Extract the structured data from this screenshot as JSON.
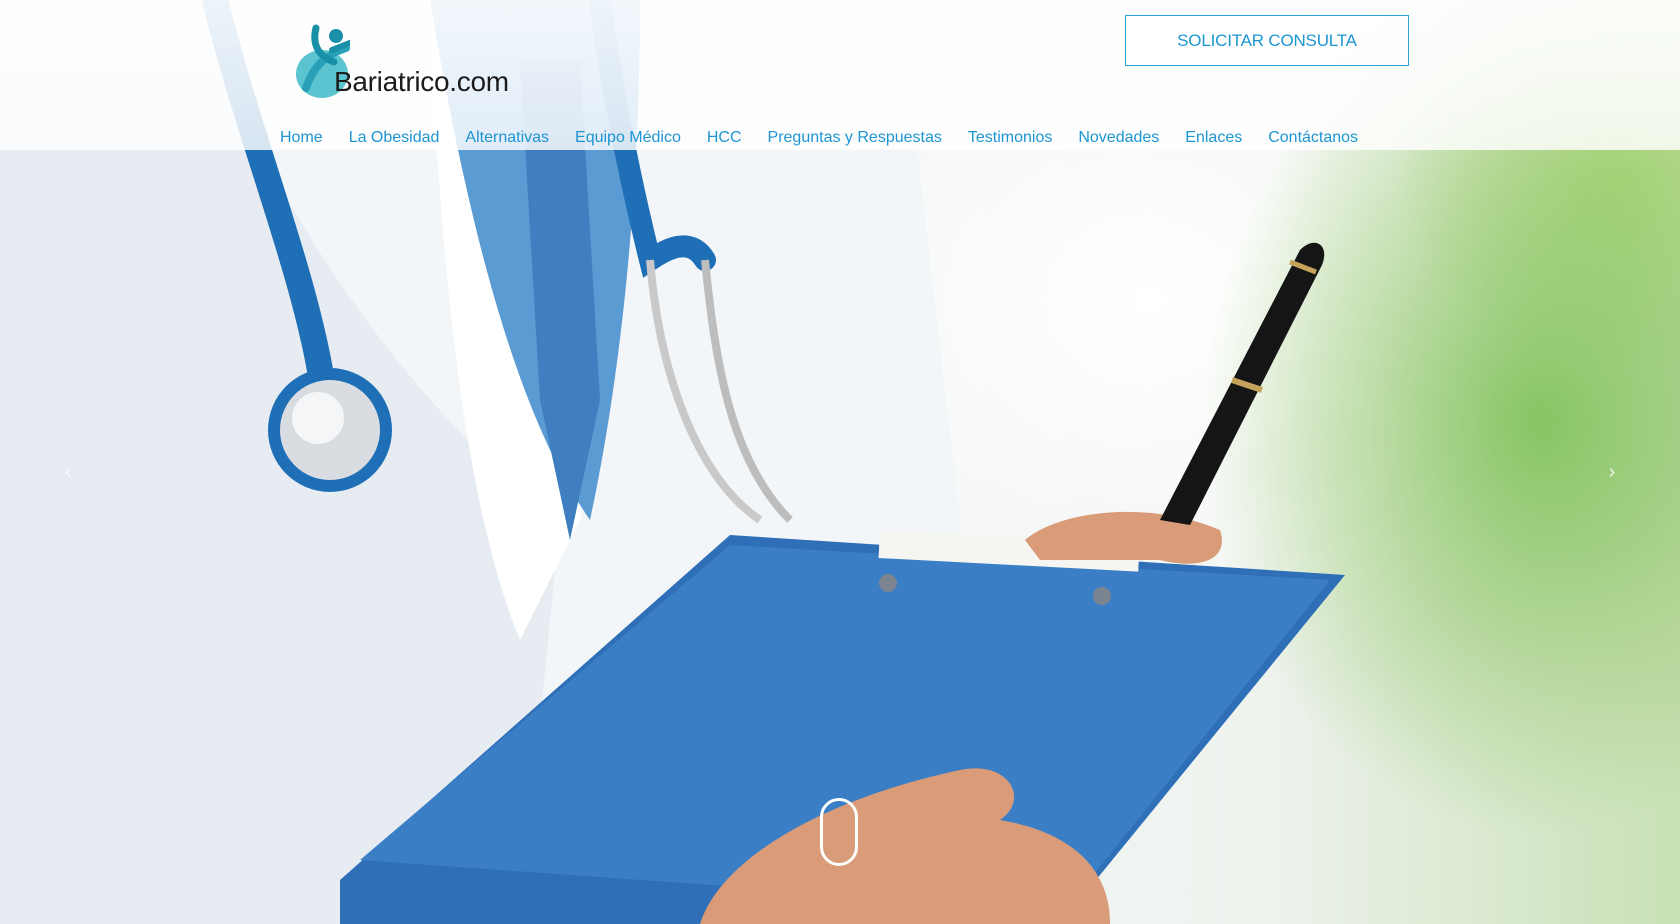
{
  "brand": {
    "name": "Bariatrico.com",
    "accent_color": "#1d95d3",
    "logo_icon": "person-swoosh-logo"
  },
  "header": {
    "cta_label": "SOLICITAR CONSULTA"
  },
  "nav": {
    "items": [
      {
        "label": "Home"
      },
      {
        "label": "La Obesidad"
      },
      {
        "label": "Alternativas"
      },
      {
        "label": "Equipo Médico"
      },
      {
        "label": "HCC"
      },
      {
        "label": "Preguntas y Respuestas"
      },
      {
        "label": "Testimonios"
      },
      {
        "label": "Novedades"
      },
      {
        "label": "Enlaces"
      },
      {
        "label": "Contáctanos"
      }
    ]
  },
  "carousel": {
    "prev_icon": "chevron-left-icon",
    "next_icon": "chevron-right-icon",
    "prev_glyph": "‹",
    "next_glyph": "›",
    "scroll_icon": "mouse-scroll-icon"
  }
}
